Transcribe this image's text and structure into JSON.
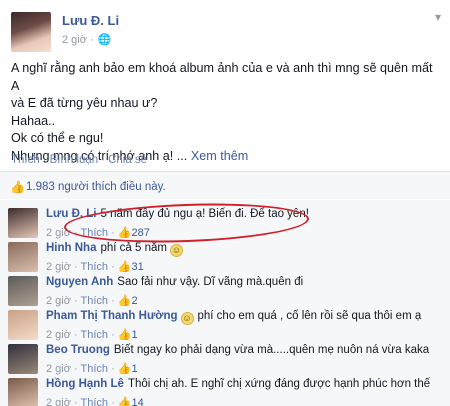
{
  "post": {
    "author": "Lưu Đ. Li",
    "time": "2 giờ ·",
    "globe_icon": "🌐",
    "chevron_icon": "chevron-down-icon",
    "lines": [
      "A nghĩ rằng anh bảo em khoá album ảnh của e và anh thì mng sẽ quên mất A",
      "và E đã từng yêu nhau ư?",
      "Hahaa..",
      "Ok có thể e ngu!",
      "Nhưng mng có trí nhớ anh ạ! ..."
    ],
    "see_more": "Xem thêm",
    "actions": {
      "like": "Thích",
      "comment": "Bình luận",
      "share": "Chia sẻ"
    }
  },
  "likes": {
    "text": "1.983 người thích điều này."
  },
  "comments": [
    {
      "name": "Lưu Đ. Li",
      "text": "5 năm đầy đủ ngu ạ! Biến đi. Để tao yên!",
      "time": "2 giờ",
      "like": "Thích",
      "count": "287"
    },
    {
      "name": "Hinh Nha",
      "text": "phí cả 5 năm",
      "time": "2 giờ",
      "like": "Thích",
      "count": "31"
    },
    {
      "name": "Nguyen Anh",
      "text": "Sao fải như vậy. Dĩ vãng mà.quên đi",
      "time": "2 giờ",
      "like": "Thích",
      "count": "2"
    },
    {
      "name": "Pham Thị Thanh Hường",
      "text": "phí cho em quá , cố lên rồi sẽ qua thôi em ạ",
      "time": "2 giờ",
      "like": "Thích",
      "count": "1"
    },
    {
      "name": "Beo Truong",
      "text": "Biết ngay ko phải dạng vừa mà.....quên mẹ nuôn ná vừa kaka",
      "time": "2 giờ",
      "like": "Thích",
      "count": "1"
    },
    {
      "name": "Hồng Hạnh Lê",
      "text": "Thôi chị ah. E nghĩ chị xứng đáng được hạnh phúc hơn thế",
      "time": "2 giờ",
      "like": "Thích",
      "count": "14"
    }
  ],
  "colors": {
    "link": "#3b5998",
    "annotation": "#d0202a"
  }
}
